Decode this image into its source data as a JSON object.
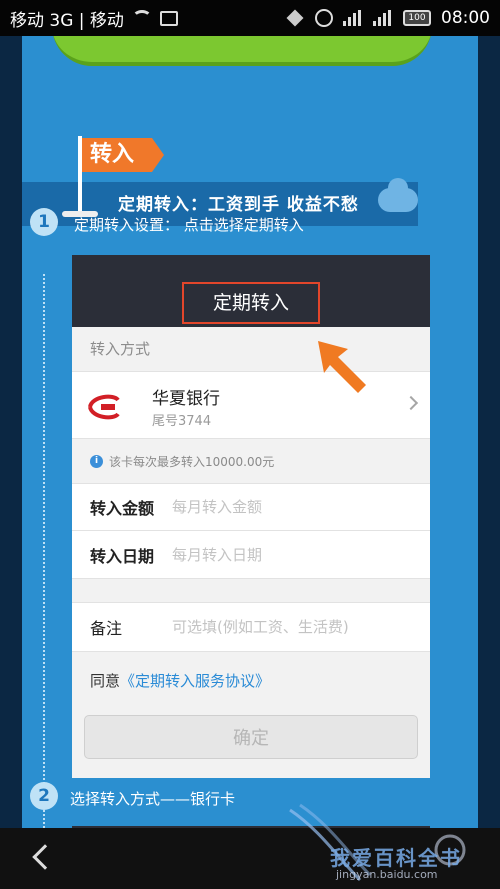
{
  "status_bar": {
    "carrier_left": "移动 3G | 移动",
    "time": "08:00",
    "battery": "100",
    "icons": [
      "wifi-icon",
      "image-icon",
      "mute-icon",
      "alarm-clock-icon",
      "signal-icon",
      "signal-icon",
      "battery-icon"
    ]
  },
  "banner": {
    "flag_label": "转入",
    "ribbon_text": "定期转入：工资到手 收益不愁"
  },
  "steps": [
    {
      "num": "1",
      "text": "定期转入设置： 点击选择定期转入"
    },
    {
      "num": "2",
      "text": "选择转入方式——银行卡"
    }
  ],
  "card": {
    "title": "定期转入",
    "section_label": "转入方式",
    "bank_name": "华夏银行",
    "bank_tail": "尾号3744",
    "info_text": "该卡每次最多转入10000.00元",
    "amount_label": "转入金额",
    "amount_placeholder": "每月转入金额",
    "date_label": "转入日期",
    "date_placeholder": "每月转入日期",
    "note_label": "备注",
    "note_placeholder": "可选填(例如工资、生活费)",
    "agree_prefix": "同意",
    "agree_link": "《定期转入服务协议》",
    "confirm_label": "确定"
  },
  "watermark": {
    "text": "我爱百科全书",
    "url": "jingyan.baidu.com"
  },
  "colors": {
    "page_blue": "#2b8fd0",
    "accent_orange": "#f0782a",
    "highlight_red": "#e2462b",
    "link_blue": "#2a8bd6"
  }
}
